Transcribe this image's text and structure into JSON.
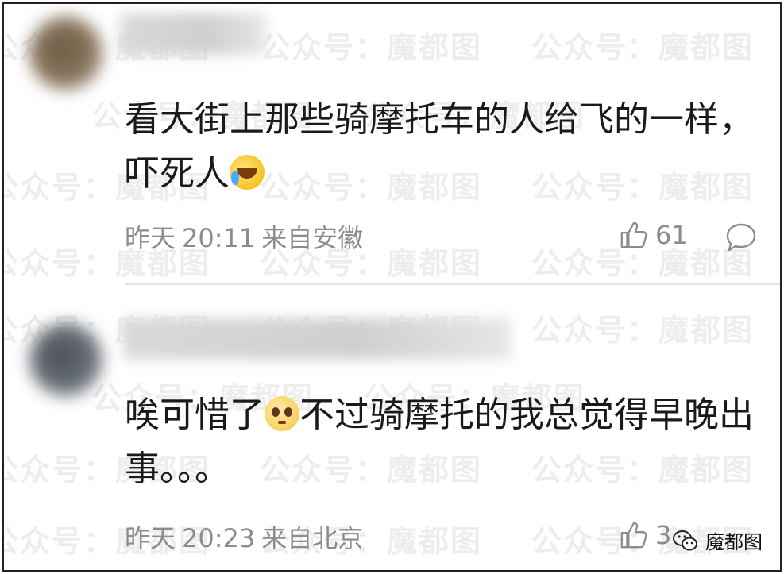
{
  "watermark": {
    "text": "公众号：魔都图"
  },
  "comments": [
    {
      "text_before": "看大街上那些骑摩托车的人给飞的一样，吓死人",
      "text_after": "",
      "emoji": "laughing-tears-emoji",
      "date": "昨天",
      "time": "20:11",
      "location": "来自安徽",
      "likes": "61"
    },
    {
      "text_before": "唉可惜了",
      "text_after": "不过骑摩托的我总觉得早晚出事。。。",
      "emoji": "pitiful-face-emoji",
      "date": "昨天",
      "time": "20:23",
      "location": "来自北京",
      "likes": "3"
    }
  ],
  "brand": {
    "name": "魔都图",
    "icon": "wechat-icon"
  },
  "colors": {
    "meta_text": "#8c8c8c",
    "body_text": "#1a1a1a",
    "divider": "#e3e3e3"
  }
}
